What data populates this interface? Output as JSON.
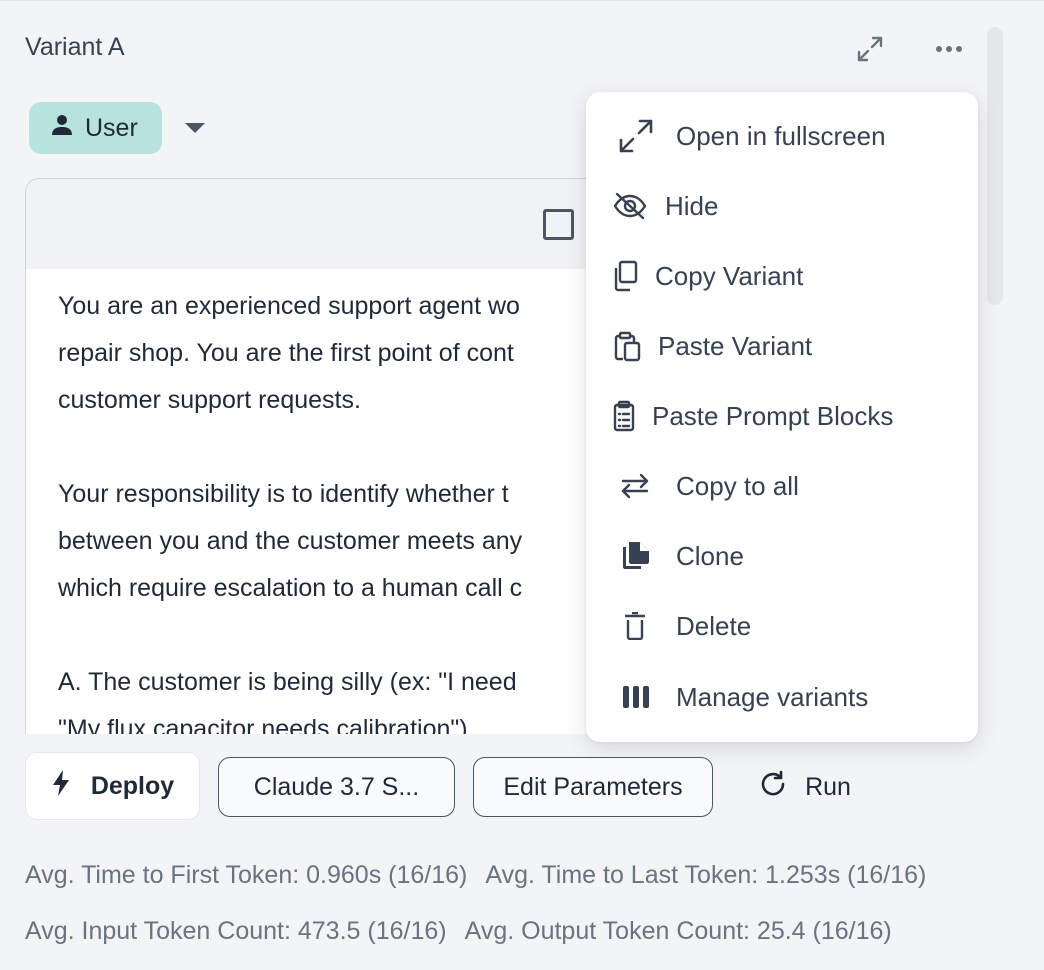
{
  "panel": {
    "title": "Variant A",
    "header_icons": [
      "expand-icon",
      "more-horizontal-icon"
    ]
  },
  "role": {
    "label": "User",
    "icon": "user-icon"
  },
  "prompt": {
    "lines": [
      "You are an experienced support agent wo",
      "repair shop. You are the first point of cont",
      "customer support requests.",
      "",
      "Your responsibility is to identify whether t",
      "between you and the customer meets any",
      "which require escalation to a human call c",
      "",
      "A. The customer is being silly (ex: \"I need",
      "\"My flux capacitor needs calibration\")"
    ]
  },
  "menu": {
    "items": [
      {
        "label": "Open in fullscreen",
        "icon": "expand-icon"
      },
      {
        "label": "Hide",
        "icon": "eye-off-icon"
      },
      {
        "label": "Copy Variant",
        "icon": "copy-icon"
      },
      {
        "label": "Paste Variant",
        "icon": "paste-icon"
      },
      {
        "label": "Paste Prompt Blocks",
        "icon": "clipboard-list-icon"
      },
      {
        "label": "Copy to all",
        "icon": "arrows-left-right-icon"
      },
      {
        "label": "Clone",
        "icon": "clone-file-icon"
      },
      {
        "label": "Delete",
        "icon": "trash-icon"
      },
      {
        "label": "Manage variants",
        "icon": "columns-icon"
      }
    ]
  },
  "actions": {
    "deploy": "Deploy",
    "model": "Claude 3.7 S...",
    "edit_parameters": "Edit Parameters",
    "run": "Run"
  },
  "stats": {
    "time_first_token": "Avg. Time to First Token: 0.960s (16/16)",
    "time_last_token": "Avg. Time to Last Token: 1.253s (16/16)",
    "input_tokens": "Avg. Input Token Count: 473.5 (16/16)",
    "output_tokens": "Avg. Output Token Count: 25.4 (16/16)"
  },
  "colors": {
    "role_pill": "#b8e3dc",
    "text": "#1f2937",
    "muted": "#6b7280",
    "background": "#f3f4f6"
  }
}
